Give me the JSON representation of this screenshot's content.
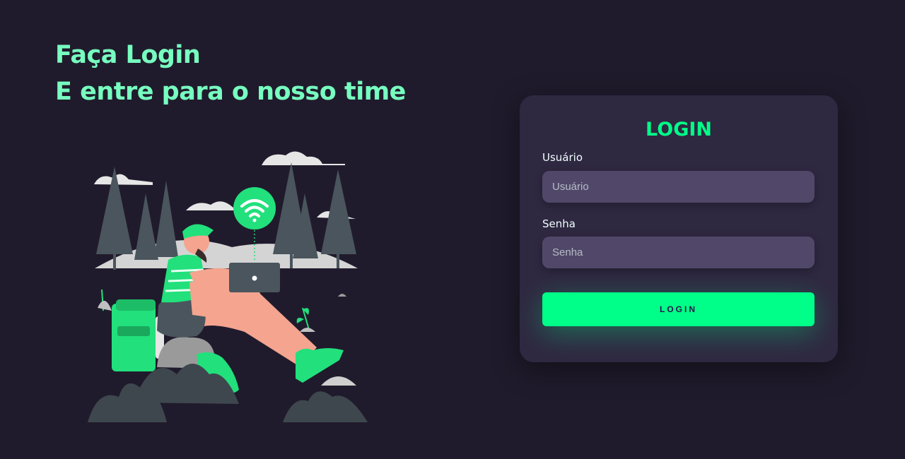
{
  "hero": {
    "line1": "Faça Login",
    "line2": "E entre para o nosso time"
  },
  "login_card": {
    "title": "LOGIN",
    "username_label": "Usuário",
    "username_placeholder": "Usuário",
    "username_value": "",
    "password_label": "Senha",
    "password_placeholder": "Senha",
    "password_value": "",
    "submit_label": "LOGIN"
  },
  "illustration": {
    "icons": [
      "wifi-icon",
      "laptop-icon",
      "backpack-icon",
      "pine-tree-icon",
      "cloud-icon"
    ]
  },
  "colors": {
    "background": "#201b2c",
    "card": "#2f2841",
    "input": "#514869",
    "accent": "#00ff88",
    "headline": "#77ffc0"
  }
}
